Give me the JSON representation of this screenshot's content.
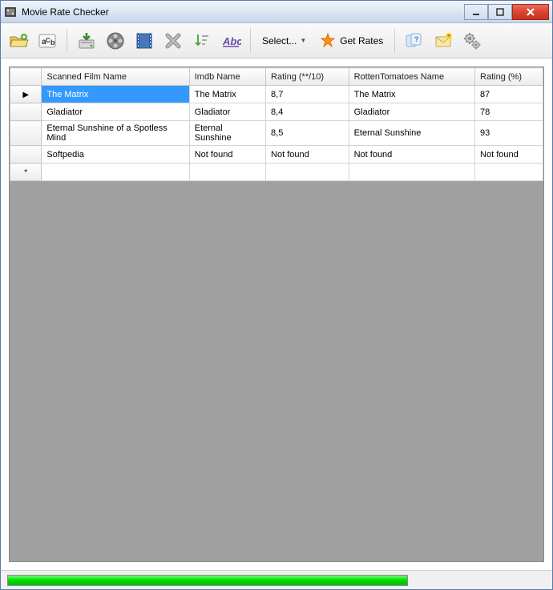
{
  "window": {
    "title": "Movie Rate Checker"
  },
  "toolbar": {
    "select_label": "Select...",
    "get_rates_label": "Get Rates"
  },
  "grid": {
    "columns": [
      "Scanned Film Name",
      "Imdb Name",
      "Rating (**/10)",
      "RottenTomatoes Name",
      "Rating (%)"
    ],
    "rows": [
      {
        "scanned": "The Matrix",
        "imdb": "The Matrix",
        "imdb_rating": "8,7",
        "rt": "The Matrix",
        "rt_rating": "87"
      },
      {
        "scanned": "Gladiator",
        "imdb": "Gladiator",
        "imdb_rating": "8,4",
        "rt": "Gladiator",
        "rt_rating": "78"
      },
      {
        "scanned": "Eternal Sunshine of a Spotless Mind",
        "imdb": "Eternal Sunshine",
        "imdb_rating": "8,5",
        "rt": "Eternal Sunshine",
        "rt_rating": "93"
      },
      {
        "scanned": "Softpedia",
        "imdb": "Not found",
        "imdb_rating": "Not found",
        "rt": "Not found",
        "rt_rating": "Not found"
      }
    ],
    "selected_index": 0
  },
  "status": {
    "progress_percent": 100
  }
}
